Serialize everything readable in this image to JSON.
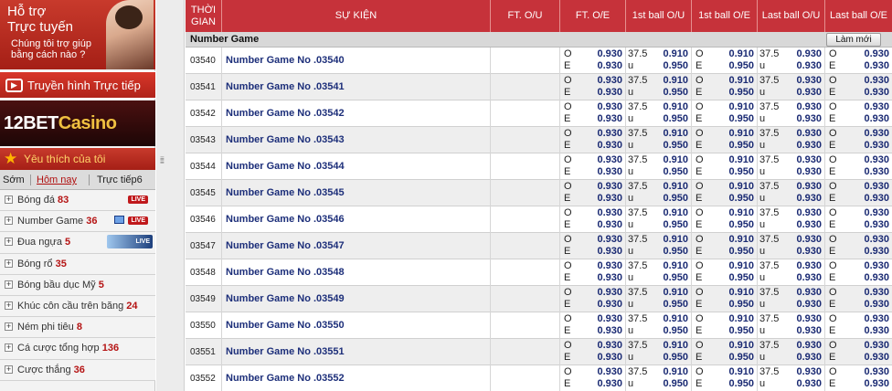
{
  "sidebar": {
    "support_title_1": "Hỗ trợ",
    "support_title_2": "Trực tuyến",
    "support_text": "Chúng tôi trợ giúp bằng cách nào ?",
    "tv_live": "Truyền hình Trực tiếp",
    "casino_brand": "12BET",
    "casino_word": "Casino",
    "favorites": "Yêu thích của tôi",
    "tabs": {
      "early": "Sớm",
      "today": "Hôm nay",
      "live": "Trực tiếp6"
    },
    "sports": [
      {
        "name": "Bóng đá",
        "count": "83",
        "badge": "live"
      },
      {
        "name": "Number Game",
        "count": "36",
        "badge": "tv-live"
      },
      {
        "name": "Đua ngựa",
        "count": "5",
        "badge": "horse-live"
      },
      {
        "name": "Bóng rổ",
        "count": "35",
        "badge": ""
      },
      {
        "name": "Bóng bầu dục Mỹ",
        "count": "5",
        "badge": ""
      },
      {
        "name": "Khúc côn cầu trên băng",
        "count": "24",
        "badge": ""
      },
      {
        "name": "Ném phi tiêu",
        "count": "8",
        "badge": ""
      },
      {
        "name": "Cá cược tổng hợp",
        "count": "136",
        "badge": ""
      },
      {
        "name": "Cược thắng",
        "count": "36",
        "badge": ""
      }
    ],
    "live_label": "LIVE"
  },
  "table": {
    "headers": {
      "time": "THỜI GIAN",
      "event": "SỰ KIỆN",
      "ft_ou": "FT. O/U",
      "ft_oe": "FT. O/E",
      "fb_ou": "1st ball O/U",
      "fb_oe": "1st ball O/E",
      "lb_ou": "Last ball O/U",
      "lb_oe": "Last ball O/E"
    },
    "group_title": "Number Game",
    "refresh_label": "Làm mới",
    "rows": [
      {
        "time": "03540",
        "event": "Number Game No .03540"
      },
      {
        "time": "03541",
        "event": "Number Game No .03541"
      },
      {
        "time": "03542",
        "event": "Number Game No .03542"
      },
      {
        "time": "03543",
        "event": "Number Game No .03543"
      },
      {
        "time": "03544",
        "event": "Number Game No .03544"
      },
      {
        "time": "03545",
        "event": "Number Game No .03545"
      },
      {
        "time": "03546",
        "event": "Number Game No .03546"
      },
      {
        "time": "03547",
        "event": "Number Game No .03547"
      },
      {
        "time": "03548",
        "event": "Number Game No .03548"
      },
      {
        "time": "03549",
        "event": "Number Game No .03549"
      },
      {
        "time": "03550",
        "event": "Number Game No .03550"
      },
      {
        "time": "03551",
        "event": "Number Game No .03551"
      },
      {
        "time": "03552",
        "event": "Number Game No .03552"
      }
    ],
    "odds": {
      "ft_oe": {
        "l1": "O",
        "l2": "E",
        "v1": "0.930",
        "v2": "0.930"
      },
      "fb_ou": {
        "h1": "37.5",
        "h2": "u",
        "v1": "0.910",
        "v2": "0.950"
      },
      "fb_oe": {
        "l1": "O",
        "l2": "E",
        "v1": "0.910",
        "v2": "0.950"
      },
      "lb_ou": {
        "h1": "37.5",
        "h2": "u",
        "v1": "0.930",
        "v2": "0.930"
      },
      "lb_oe": {
        "l1": "O",
        "l2": "E",
        "v1": "0.930",
        "v2": "0.930"
      }
    }
  }
}
